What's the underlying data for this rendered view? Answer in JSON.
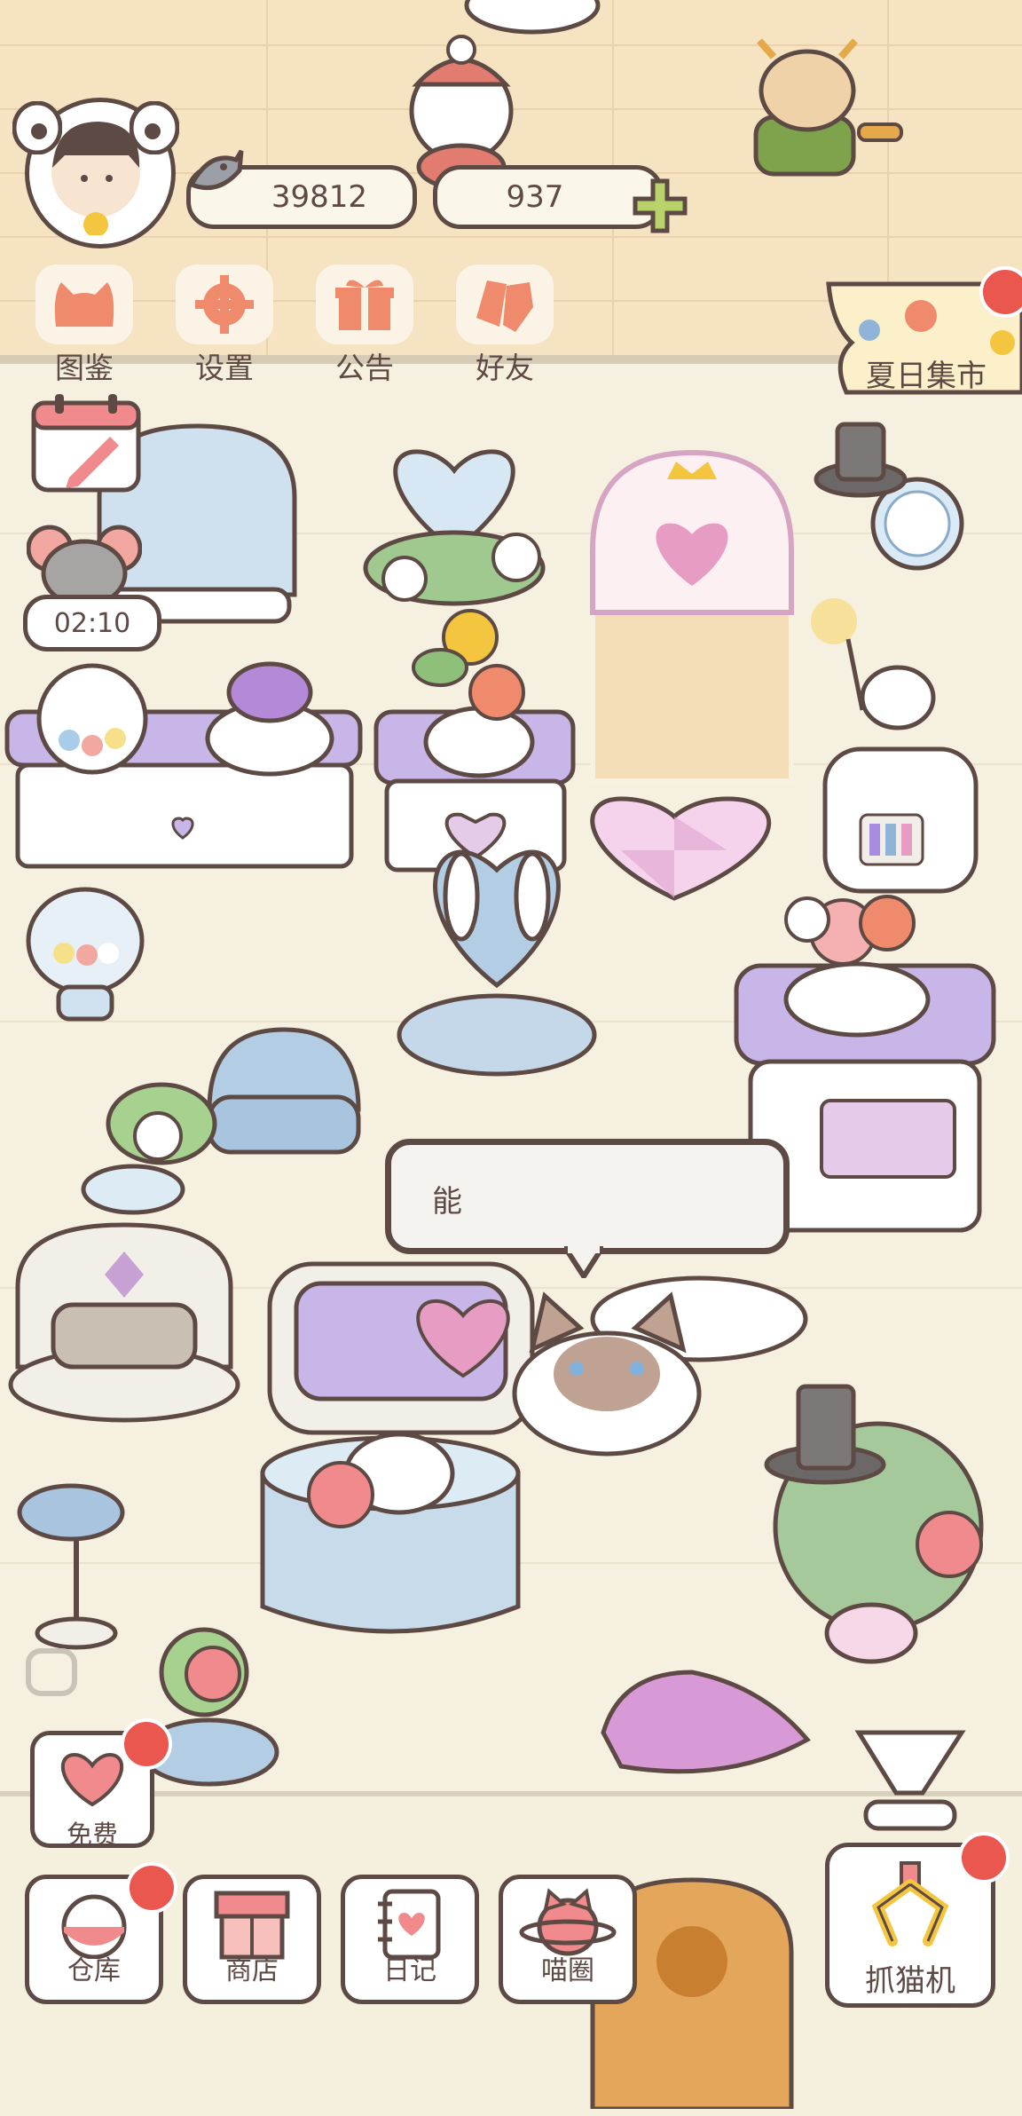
{
  "hud": {
    "fish_count": "39812",
    "gem_count": "937"
  },
  "menu": {
    "items": [
      {
        "label": "图鉴",
        "icon": "cat-head-icon"
      },
      {
        "label": "设置",
        "icon": "gear-icon"
      },
      {
        "label": "公告",
        "icon": "gift-icon"
      },
      {
        "label": "好友",
        "icon": "friends-icon"
      }
    ]
  },
  "event": {
    "label": "夏日集市"
  },
  "timer": {
    "value": "02:10"
  },
  "speech_bubble": {
    "text": "能"
  },
  "free_button": {
    "label": "免费"
  },
  "bottom_nav": [
    {
      "label": "仓库",
      "icon": "warehouse-icon",
      "badge": true
    },
    {
      "label": "商店",
      "icon": "shop-icon",
      "badge": false
    },
    {
      "label": "日记",
      "icon": "diary-icon",
      "badge": false
    },
    {
      "label": "喵圈",
      "icon": "cat-planet-icon",
      "badge": false
    }
  ],
  "claw_machine": {
    "label": "抓猫机"
  },
  "colors": {
    "outline": "#5e4a44",
    "accent": "#f08a6c",
    "badge": "#e9574f",
    "wall": "#f5e3c2",
    "floor": "#f6f0e0"
  }
}
